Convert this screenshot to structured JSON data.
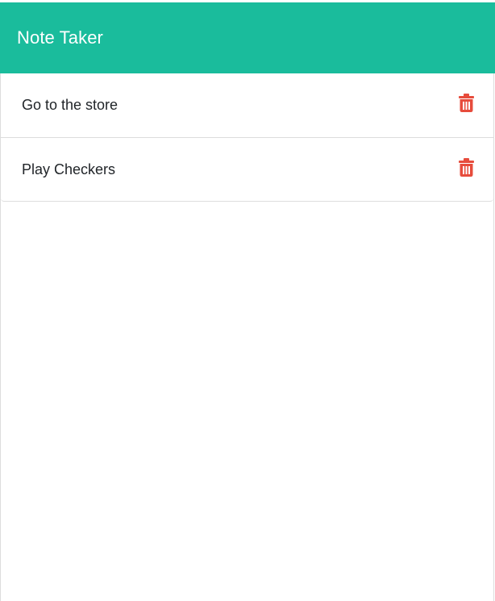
{
  "app": {
    "title": "Note Taker"
  },
  "notes": [
    {
      "title": "Go to the store",
      "action_icon": "trash-icon"
    },
    {
      "title": "Play Checkers",
      "action_icon": "trash-icon"
    }
  ],
  "colors": {
    "header_bg": "#1abc9c",
    "header_text": "#ffffff",
    "delete_icon": "#e74c3c",
    "border": "#dddddd",
    "text": "#212529"
  }
}
